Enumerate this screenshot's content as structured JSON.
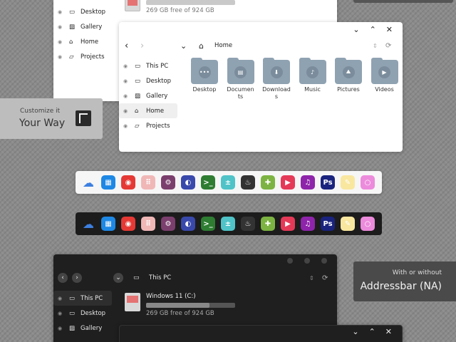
{
  "top_window": {
    "sidebar": [
      "Desktop",
      "Gallery",
      "Home",
      "Projects"
    ],
    "drive_free": "269 GB free of 924 GB"
  },
  "main_window": {
    "path": "Home",
    "sidebar": [
      "This PC",
      "Desktop",
      "Gallery",
      "Home",
      "Projects"
    ],
    "selected": "Home",
    "folders": [
      {
        "label": "Desktop",
        "icon": "dots-icon"
      },
      {
        "label": "Documents",
        "icon": "document-icon"
      },
      {
        "label": "Downloads",
        "icon": "download-icon"
      },
      {
        "label": "Music",
        "icon": "music-icon"
      },
      {
        "label": "Pictures",
        "icon": "picture-icon"
      },
      {
        "label": "Videos",
        "icon": "video-icon"
      }
    ],
    "folder_color": "#8fa2b2"
  },
  "customize_card": {
    "line1": "Customize it",
    "line2": "Your Way"
  },
  "addressbar_card": {
    "line1": "With or without",
    "line2": "Addressbar (NA)"
  },
  "dock_apps": [
    {
      "name": "cloud-app-icon",
      "color": "#3d7fe0",
      "glyph": "☁"
    },
    {
      "name": "start-menu-icon",
      "color": "#1e88e5",
      "glyph": "▦"
    },
    {
      "name": "chrome-icon",
      "color": "#e53935",
      "glyph": "◉"
    },
    {
      "name": "apps-grid-icon",
      "color": "#f0b7b7",
      "glyph": "⠿"
    },
    {
      "name": "settings-icon",
      "color": "#7b3f6e",
      "glyph": "⚙"
    },
    {
      "name": "toggle-app-icon",
      "color": "#3949ab",
      "glyph": "◐"
    },
    {
      "name": "terminal-icon",
      "color": "#2e7d32",
      "glyph": ">_"
    },
    {
      "name": "calculator-icon",
      "color": "#4fc3c7",
      "glyph": "±"
    },
    {
      "name": "steam-icon",
      "color": "#333333",
      "glyph": "♨"
    },
    {
      "name": "gamepad-icon",
      "color": "#7cb342",
      "glyph": "✚"
    },
    {
      "name": "media-player-icon",
      "color": "#e53958",
      "glyph": "▶"
    },
    {
      "name": "music-app-icon",
      "color": "#8e24aa",
      "glyph": "♫"
    },
    {
      "name": "photoshop-icon",
      "color": "#1a237e",
      "glyph": "Ps"
    },
    {
      "name": "paint-icon",
      "color": "#f9e79f",
      "glyph": "✎"
    },
    {
      "name": "colors-app-icon",
      "color": "#ec8bdc",
      "glyph": "○"
    }
  ],
  "dark_window": {
    "path": "This PC",
    "sidebar": [
      "This PC",
      "Desktop",
      "Gallery"
    ],
    "selected": "This PC",
    "drive_name": "Windows 11 (C:)",
    "drive_free": "269 GB free of 924 GB",
    "drive_fill": 0.71
  },
  "glyphs": {
    "back": "‹",
    "forward": "›",
    "down": "⌄",
    "min": "⌄",
    "max": "⌃",
    "close": "✕",
    "refresh": "⟳",
    "updown": "⇕"
  }
}
